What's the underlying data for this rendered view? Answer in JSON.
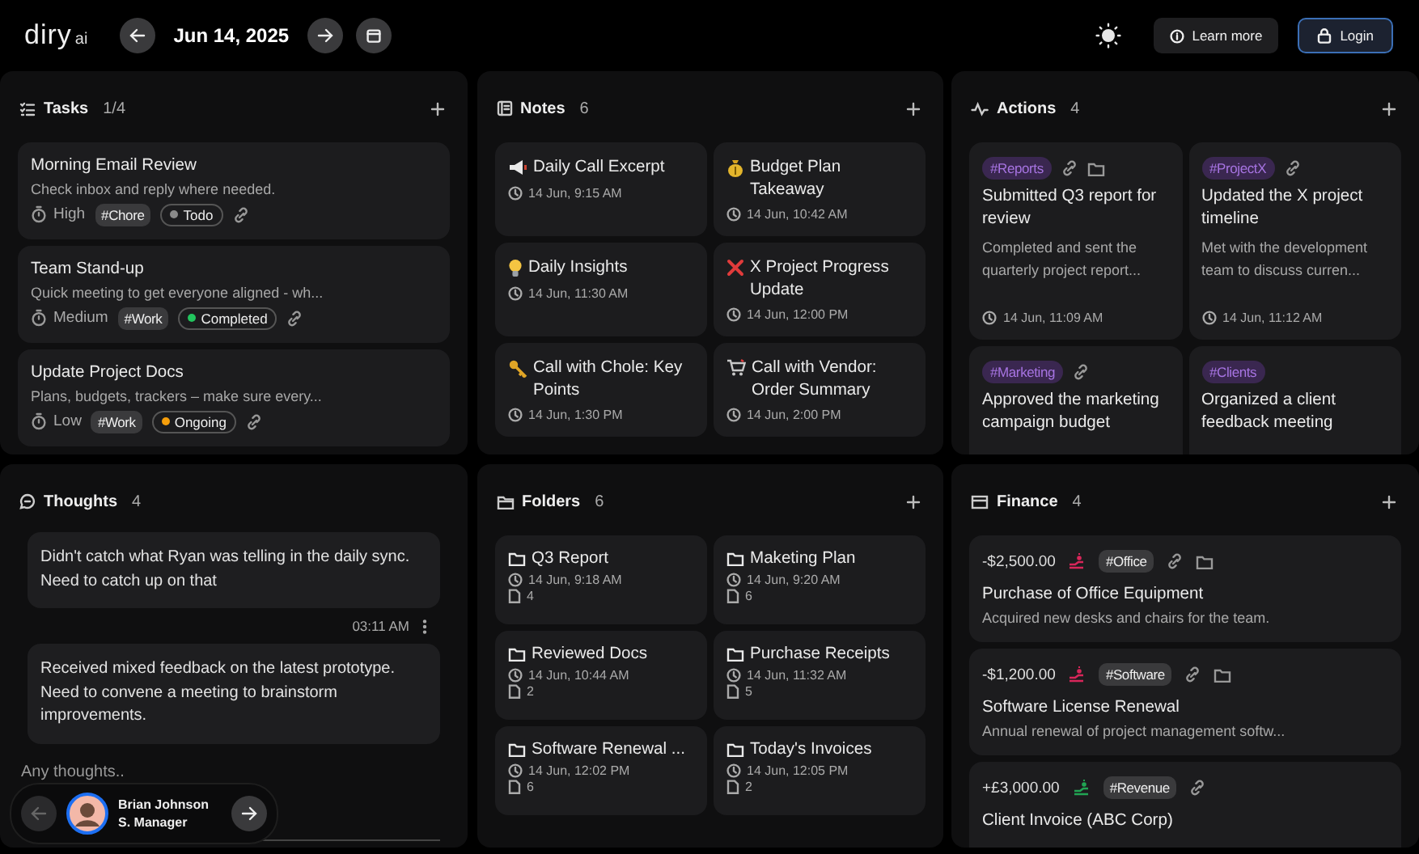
{
  "header": {
    "logo": "diry",
    "logo_suffix": "ai",
    "date": "Jun 14, 2025",
    "learn_more": "Learn more",
    "login": "Login"
  },
  "tasks": {
    "title": "Tasks",
    "count": "1/4",
    "items": [
      {
        "title": "Morning Email Review",
        "description": "Check inbox and reply where needed.",
        "priority": "High",
        "tag": "#Chore",
        "status": {
          "label": "Todo",
          "color": "#8a8a8a"
        }
      },
      {
        "title": "Team Stand-up",
        "description": "Quick meeting to get everyone aligned - wh...",
        "priority": "Medium",
        "tag": "#Work",
        "status": {
          "label": "Completed",
          "color": "#22c55e"
        }
      },
      {
        "title": "Update Project Docs",
        "description": "Plans, budgets, trackers – make sure every...",
        "priority": "Low",
        "tag": "#Work",
        "status": {
          "label": "Ongoing",
          "color": "#f59e0b"
        }
      }
    ]
  },
  "notes": {
    "title": "Notes",
    "count": "6",
    "items": [
      {
        "kind": "megaphone",
        "title": "Daily Call Excerpt",
        "time": "14 Jun, 9:15 AM"
      },
      {
        "kind": "moneybag",
        "title": "Budget Plan Takeaway",
        "time": "14 Jun, 10:42 AM"
      },
      {
        "kind": "bulb",
        "title": "Daily Insights",
        "time": "14 Jun, 11:30 AM"
      },
      {
        "kind": "cross",
        "title": "X Project Progress Update",
        "time": "14 Jun, 12:00 PM"
      },
      {
        "kind": "key",
        "title": "Call with Chole: Key Points",
        "time": "14 Jun, 1:30 PM"
      },
      {
        "kind": "cart",
        "title": "Call with Vendor: Order Summary",
        "time": "14 Jun, 2:00 PM"
      }
    ]
  },
  "actions": {
    "title": "Actions",
    "count": "4",
    "items": [
      {
        "tag": "#Reports",
        "link": true,
        "folder": true,
        "title": "Submitted Q3 report for review",
        "description": "Completed and sent the quarterly project report...",
        "time": "14 Jun, 11:09 AM"
      },
      {
        "tag": "#ProjectX",
        "link": true,
        "folder": false,
        "title": "Updated the X project timeline",
        "description": "Met with the development team to discuss curren...",
        "time": "14 Jun, 11:12 AM"
      },
      {
        "tag": "#Marketing",
        "link": true,
        "folder": false,
        "title": "Approved the marketing campaign budget"
      },
      {
        "tag": "#Clients",
        "link": false,
        "folder": false,
        "title": "Organized a client feedback meeting"
      }
    ]
  },
  "thoughts": {
    "title": "Thoughts",
    "count": "4",
    "items": [
      {
        "text": "Didn't catch what Ryan was telling in the daily sync. Need to catch up on that",
        "time": "03:11 AM"
      },
      {
        "text": "Received mixed feedback on the latest prototype. Need to convene a meeting to brainstorm improvements."
      }
    ],
    "placeholder": "Any thoughts..",
    "user": {
      "name": "Brian Johnson",
      "role": "S. Manager"
    }
  },
  "folders": {
    "title": "Folders",
    "count": "6",
    "items": [
      {
        "name": "Q3 Report",
        "time": "14 Jun, 9:18 AM",
        "files": "4"
      },
      {
        "name": "Maketing Plan",
        "time": "14 Jun, 9:20 AM",
        "files": "6"
      },
      {
        "name": "Reviewed Docs",
        "time": "14 Jun, 10:44 AM",
        "files": "2"
      },
      {
        "name": "Purchase Receipts",
        "time": "14 Jun, 11:32 AM",
        "files": "5"
      },
      {
        "name": "Software Renewal ...",
        "time": "14 Jun, 12:02 PM",
        "files": "6"
      },
      {
        "name": "Today's Invoices",
        "time": "14 Jun, 12:05 PM",
        "files": "2"
      }
    ]
  },
  "finance": {
    "title": "Finance",
    "count": "4",
    "items": [
      {
        "kind": "expense",
        "amount": "-$2,500.00",
        "tag": "#Office",
        "folder": true,
        "title": "Purchase of Office Equipment",
        "description": "Acquired new desks and chairs for the team."
      },
      {
        "kind": "expense",
        "amount": "-$1,200.00",
        "tag": "#Software",
        "folder": true,
        "title": "Software License Renewal",
        "description": "Annual renewal of project management softw..."
      },
      {
        "kind": "income",
        "amount": "+£3,000.00",
        "tag": "#Revenue",
        "folder": false,
        "title": "Client Invoice (ABC Corp)"
      }
    ]
  }
}
